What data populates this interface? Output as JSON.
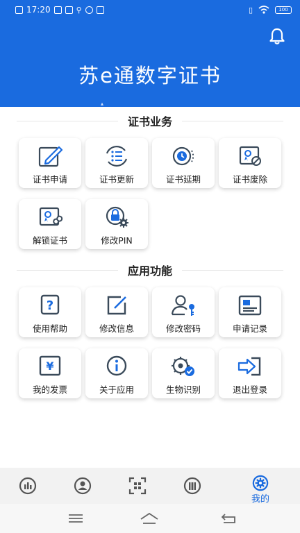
{
  "status_bar": {
    "time": "17:20",
    "battery": "100"
  },
  "header": {
    "title": "苏e通数字证书"
  },
  "sections": {
    "cert": {
      "title": "证书业务",
      "items": [
        {
          "label": "证书申请",
          "icon": "edit-form-icon"
        },
        {
          "label": "证书更新",
          "icon": "refresh-list-icon"
        },
        {
          "label": "证书延期",
          "icon": "clock-extend-icon"
        },
        {
          "label": "证书废除",
          "icon": "certificate-revoke-icon"
        },
        {
          "label": "解锁证书",
          "icon": "certificate-unlock-icon"
        },
        {
          "label": "修改PIN",
          "icon": "lock-gear-icon"
        }
      ]
    },
    "app": {
      "title": "应用功能",
      "items": [
        {
          "label": "使用帮助",
          "icon": "help-icon"
        },
        {
          "label": "修改信息",
          "icon": "edit-info-icon"
        },
        {
          "label": "修改密码",
          "icon": "user-key-icon"
        },
        {
          "label": "申请记录",
          "icon": "record-card-icon"
        },
        {
          "label": "我的发票",
          "icon": "invoice-yen-icon"
        },
        {
          "label": "关于应用",
          "icon": "info-icon"
        },
        {
          "label": "生物识别",
          "icon": "biometric-icon"
        },
        {
          "label": "退出登录",
          "icon": "logout-icon"
        }
      ]
    }
  },
  "tabbar": {
    "active_label": "我的"
  },
  "colors": {
    "primary": "#1a6bdf",
    "icon_dark": "#3a4a5a"
  }
}
